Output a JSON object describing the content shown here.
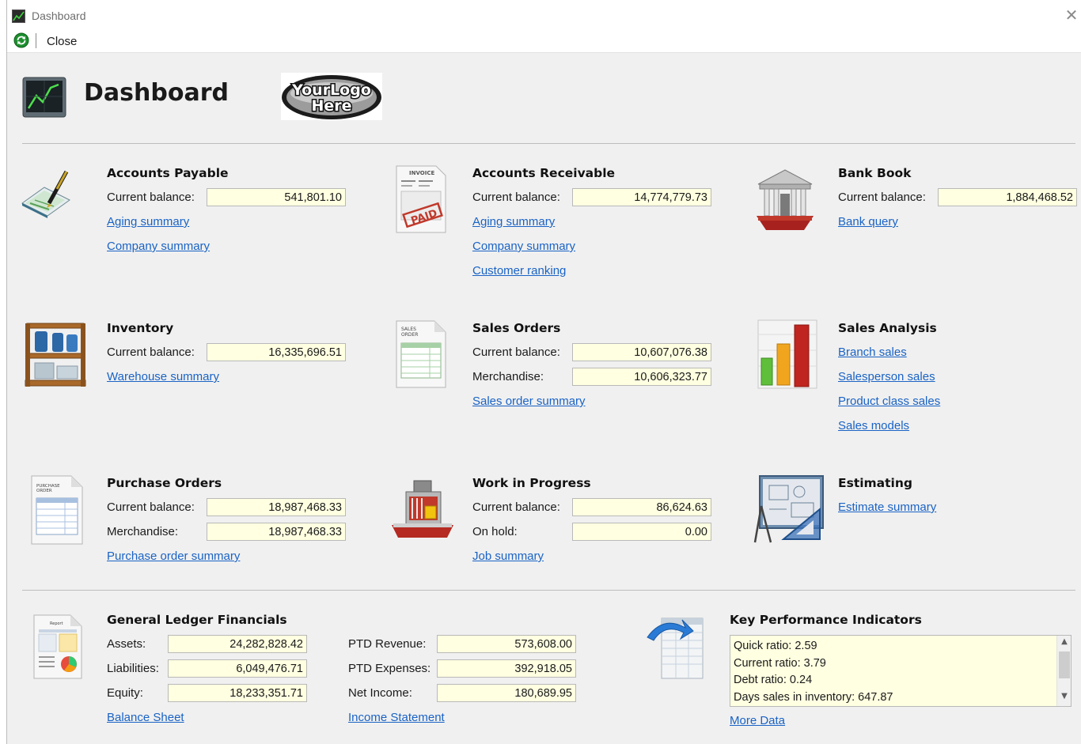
{
  "window": {
    "title": "Dashboard",
    "close_glyph": "✕"
  },
  "toolbar": {
    "close_label": "Close"
  },
  "header": {
    "title": "Dashboard",
    "logo_text_top": "YourLogo",
    "logo_text_bottom": "Here"
  },
  "accounts_payable": {
    "title": "Accounts Payable",
    "balance_label": "Current balance:",
    "balance_value": "541,801.10",
    "links": [
      "Aging summary",
      "Company summary"
    ]
  },
  "accounts_receivable": {
    "title": "Accounts Receivable",
    "balance_label": "Current balance:",
    "balance_value": "14,774,779.73",
    "links": [
      "Aging summary",
      "Company summary",
      "Customer ranking"
    ]
  },
  "bank_book": {
    "title": "Bank Book",
    "balance_label": "Current balance:",
    "balance_value": "1,884,468.52",
    "links": [
      "Bank query"
    ]
  },
  "inventory": {
    "title": "Inventory",
    "balance_label": "Current balance:",
    "balance_value": "16,335,696.51",
    "links": [
      "Warehouse summary"
    ]
  },
  "sales_orders": {
    "title": "Sales Orders",
    "balance_label": "Current balance:",
    "balance_value": "10,607,076.38",
    "merch_label": "Merchandise:",
    "merch_value": "10,606,323.77",
    "links": [
      "Sales order summary"
    ]
  },
  "sales_analysis": {
    "title": "Sales Analysis",
    "links": [
      "Branch sales",
      "Salesperson sales",
      "Product class sales",
      "Sales models"
    ]
  },
  "purchase_orders": {
    "title": "Purchase Orders",
    "balance_label": "Current balance:",
    "balance_value": "18,987,468.33",
    "merch_label": "Merchandise:",
    "merch_value": "18,987,468.33",
    "links": [
      "Purchase order summary"
    ]
  },
  "work_in_progress": {
    "title": "Work in Progress",
    "balance_label": "Current balance:",
    "balance_value": "86,624.63",
    "hold_label": "On hold:",
    "hold_value": "0.00",
    "links": [
      "Job summary"
    ]
  },
  "estimating": {
    "title": "Estimating",
    "links": [
      "Estimate summary"
    ]
  },
  "general_ledger": {
    "title": "General Ledger Financials",
    "assets_label": "Assets:",
    "assets_value": "24,282,828.42",
    "liabilities_label": "Liabilities:",
    "liabilities_value": "6,049,476.71",
    "equity_label": "Equity:",
    "equity_value": "18,233,351.71",
    "revenue_label": "PTD Revenue:",
    "revenue_value": "573,608.00",
    "expenses_label": "PTD Expenses:",
    "expenses_value": "392,918.05",
    "net_label": "Net Income:",
    "net_value": "180,689.95",
    "links": [
      "Balance Sheet",
      "Income Statement"
    ]
  },
  "kpi": {
    "title": "Key Performance Indicators",
    "lines": [
      "Quick ratio: 2.59",
      "Current ratio: 3.79",
      "Debt ratio: 0.24",
      "Days sales in inventory: 647.87"
    ],
    "more_link": "More Data"
  },
  "icons": {
    "accounts_payable": "checkbook-pen-icon",
    "accounts_receivable": "paid-invoice-icon",
    "bank_book": "bank-building-icon",
    "inventory": "warehouse-shelf-icon",
    "sales_orders": "sales-order-document-icon",
    "sales_analysis": "bar-chart-icon",
    "purchase_orders": "purchase-order-document-icon",
    "work_in_progress": "factory-icon",
    "estimating": "blueprint-icon",
    "general_ledger": "report-document-icon",
    "kpi": "spreadsheet-arrow-icon"
  },
  "colors": {
    "link": "#1a63c5",
    "value_bg": "#ffffe1",
    "window_bg": "#f0f0f0"
  }
}
